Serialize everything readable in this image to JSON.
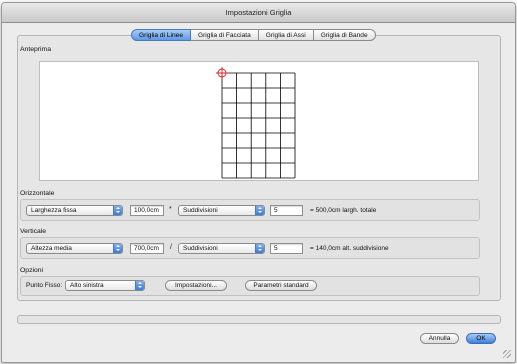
{
  "window": {
    "title": "Impostazioni Griglia"
  },
  "tabs": [
    {
      "label": "Griglia di Linee",
      "active": true
    },
    {
      "label": "Griglia di Facciata",
      "active": false
    },
    {
      "label": "Griglia di Assi",
      "active": false
    },
    {
      "label": "Griglia di Bande",
      "active": false
    }
  ],
  "preview": {
    "label": "Anteprima",
    "columns": 5,
    "rows": 7,
    "marker_color": "#d62020",
    "grid_color": "#000000"
  },
  "horizontal": {
    "label": "Orizzontale",
    "mode_value": "Larghezza fissa",
    "size_value": "100,0cm",
    "operator": "*",
    "subdiv_value": "Suddivisioni",
    "count_value": "5",
    "result": "= 500,0cm largh. totale"
  },
  "vertical": {
    "label": "Verticale",
    "mode_value": "Altezza media",
    "size_value": "700,0cm",
    "operator": "/",
    "subdiv_value": "Suddivisioni",
    "count_value": "5",
    "result": "= 140,0cm alt. suddivisione"
  },
  "options": {
    "label": "Opzioni",
    "fixed_point_label": "Punto Fisso:",
    "fixed_point_value": "Alto sinistra",
    "settings_button": "Impostazioni...",
    "defaults_button": "Parametri standard"
  },
  "footer": {
    "cancel_button": "Annulla",
    "ok_button": "OK"
  },
  "colors": {
    "accent": "#5d9ae6"
  }
}
